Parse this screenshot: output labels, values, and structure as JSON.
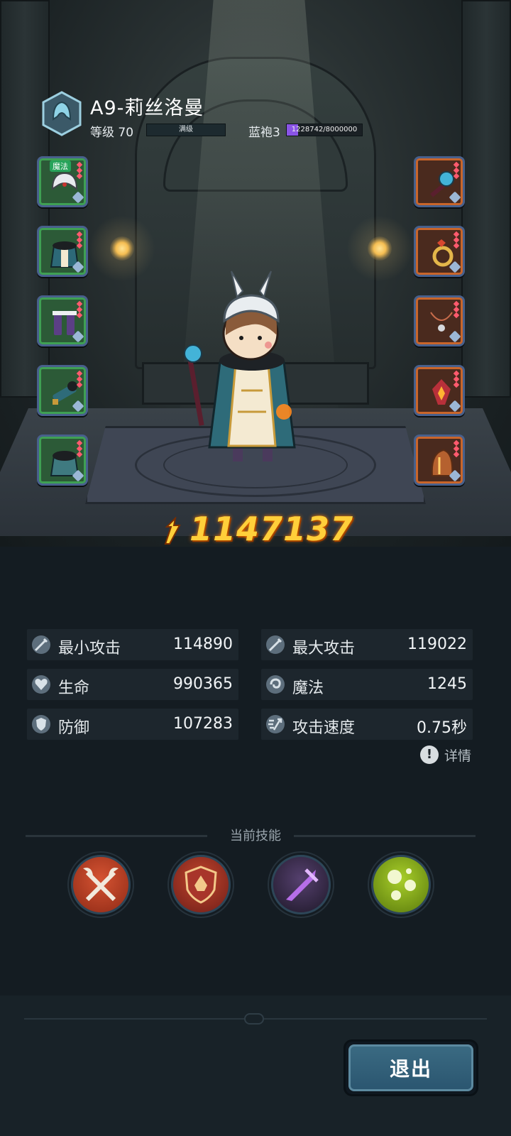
{
  "header": {
    "character_name": "A9-莉丝洛曼",
    "level_label": "等级 70",
    "level_bar_text": "满级",
    "rank_label": "蓝袍3",
    "exp_text": "1228742/8000000",
    "exp_fraction": 0.154
  },
  "equipment": {
    "left": [
      {
        "name": "helmet",
        "tag": "魔法",
        "rarity": "green"
      },
      {
        "name": "armor",
        "rarity": "green"
      },
      {
        "name": "boots",
        "rarity": "green"
      },
      {
        "name": "bracer",
        "rarity": "green"
      },
      {
        "name": "cloak",
        "rarity": "green"
      }
    ],
    "right": [
      {
        "name": "staff",
        "rarity": "orange"
      },
      {
        "name": "ring",
        "rarity": "orange"
      },
      {
        "name": "necklace",
        "rarity": "orange"
      },
      {
        "name": "emblem",
        "rarity": "orange"
      },
      {
        "name": "mask",
        "rarity": "orange"
      }
    ]
  },
  "power": {
    "value": "1147137"
  },
  "stats": {
    "min_attack": {
      "label": "最小攻击",
      "value": "114890",
      "icon": "sword-icon"
    },
    "max_attack": {
      "label": "最大攻击",
      "value": "119022",
      "icon": "sword-icon"
    },
    "hp": {
      "label": "生命",
      "value": "990365",
      "icon": "heart-icon"
    },
    "mp": {
      "label": "魔法",
      "value": "1245",
      "icon": "magic-swirl-icon"
    },
    "defense": {
      "label": "防御",
      "value": "107283",
      "icon": "shield-icon"
    },
    "attack_speed": {
      "label": "攻击速度",
      "value": "0.75秒",
      "icon": "speed-icon"
    }
  },
  "detail": {
    "label": "详情"
  },
  "skills": {
    "title": "当前技能",
    "items": [
      {
        "name": "crossed-axes",
        "color": "#b43a22"
      },
      {
        "name": "crest-shield",
        "color": "#8e2b23"
      },
      {
        "name": "purple-blade",
        "color": "#3a2a4a"
      },
      {
        "name": "green-orbs",
        "color": "#7ea81a"
      }
    ]
  },
  "footer": {
    "exit_label": "退出"
  },
  "colors": {
    "power": "#ffcf3a",
    "exp": "#8a54e6",
    "button": "#2b5670"
  }
}
